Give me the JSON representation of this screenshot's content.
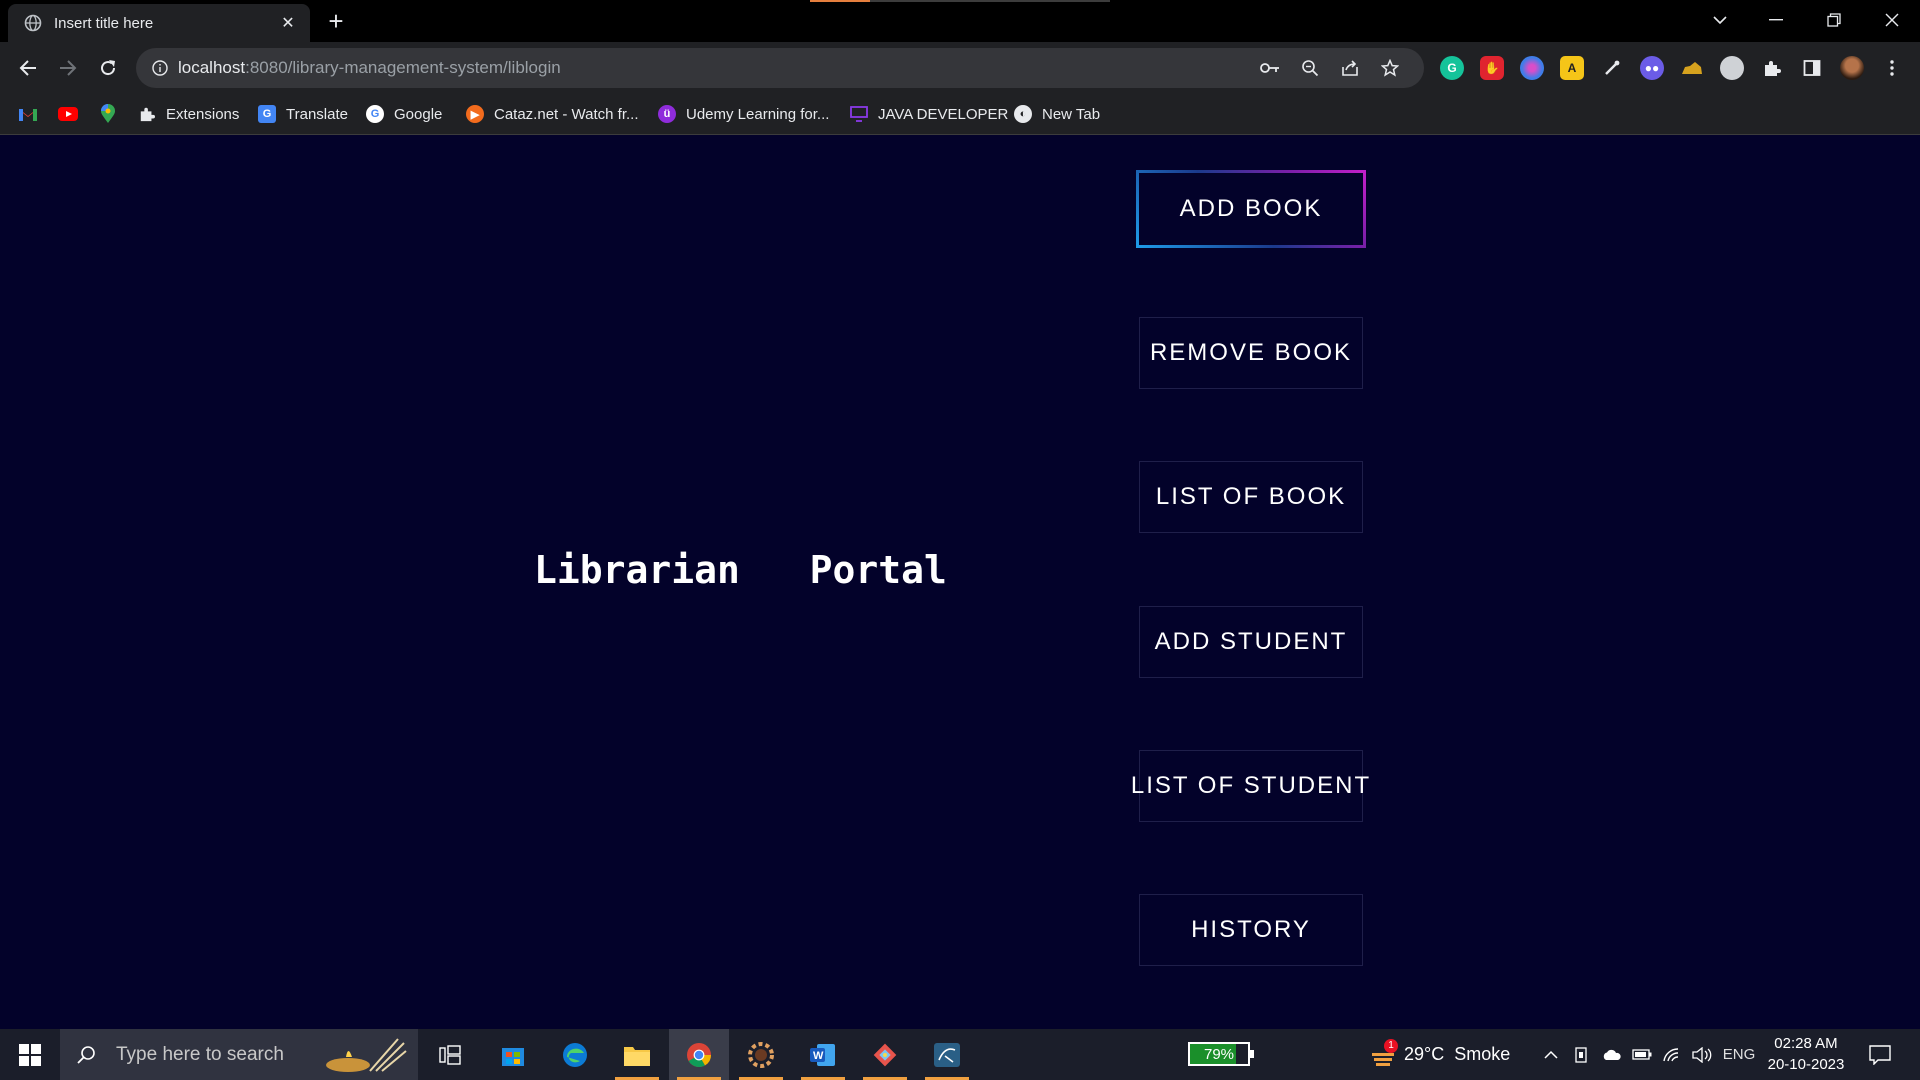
{
  "browser": {
    "tab": {
      "title": "Insert title here"
    },
    "address": {
      "host": "localhost",
      "path": ":8080/library-management-system/liblogin"
    },
    "bookmarks": [
      {
        "label": "Extensions"
      },
      {
        "label": "Translate"
      },
      {
        "label": "Google"
      },
      {
        "label": "Cataz.net - Watch fr..."
      },
      {
        "label": "Udemy Learning for..."
      },
      {
        "label": "JAVA DEVELOPER"
      },
      {
        "label": "New Tab"
      }
    ]
  },
  "page": {
    "title": "Librarian  Portal",
    "buttons": [
      {
        "label": "ADD BOOK"
      },
      {
        "label": "REMOVE BOOK"
      },
      {
        "label": "LIST OF BOOK"
      },
      {
        "label": "ADD STUDENT"
      },
      {
        "label": "LIST OF STUDENT"
      },
      {
        "label": "HISTORY"
      }
    ],
    "background_color": "#03022a"
  },
  "taskbar": {
    "search_placeholder": "Type here to search",
    "battery": "79%",
    "battery_level": 0.79,
    "weather": {
      "temp": "29°C",
      "condition": "Smoke",
      "alert_count": "1"
    },
    "language": "ENG",
    "time": "02:28 AM",
    "date": "20-10-2023"
  }
}
